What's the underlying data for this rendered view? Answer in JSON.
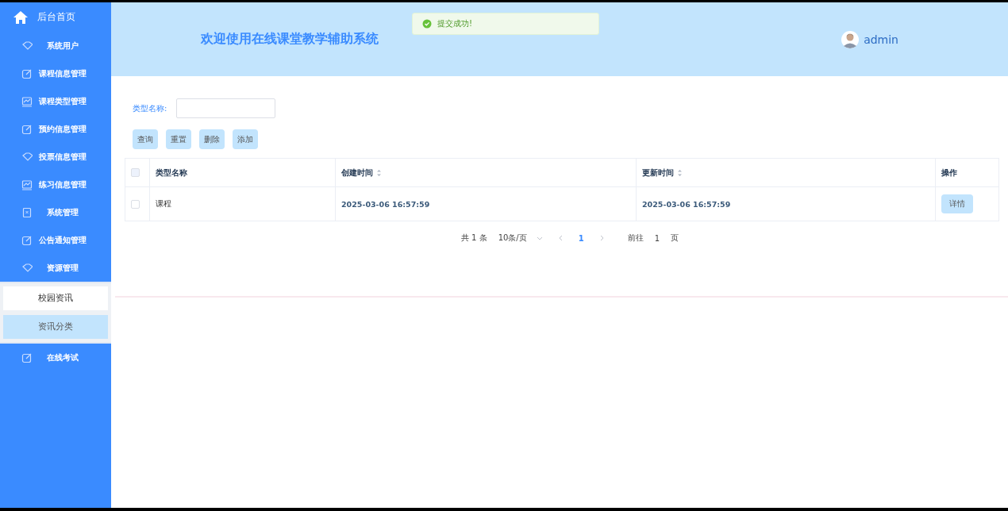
{
  "sidebar": {
    "home": "后台首页",
    "items": [
      {
        "label": "系统用户",
        "kind": "diamond"
      },
      {
        "label": "课程信息管理",
        "kind": "edit"
      },
      {
        "label": "课程类型管理",
        "kind": "chart"
      },
      {
        "label": "预约信息管理",
        "kind": "edit"
      },
      {
        "label": "投票信息管理",
        "kind": "diamond"
      },
      {
        "label": "练习信息管理",
        "kind": "chart"
      },
      {
        "label": "系统管理",
        "kind": "doc"
      },
      {
        "label": "公告通知管理",
        "kind": "edit"
      },
      {
        "label": "资源管理",
        "kind": "diamond",
        "expanded": true,
        "children": [
          {
            "label": "校园资讯",
            "selected": false
          },
          {
            "label": "资讯分类",
            "selected": true
          }
        ]
      },
      {
        "label": "在线考试",
        "kind": "edit",
        "expanded": false
      }
    ]
  },
  "header": {
    "title": "欢迎使用在线课堂教学辅助系统",
    "user": "admin"
  },
  "toast": {
    "kind": "success",
    "message": "提交成功!"
  },
  "filter": {
    "label": "类型名称:"
  },
  "buttons": [
    "查询",
    "重置",
    "删除",
    "添加"
  ],
  "table": {
    "all_checked": false,
    "columns": [
      {
        "label": "类型名称",
        "sortable": false
      },
      {
        "label": "创建时间",
        "sortable": true
      },
      {
        "label": "更新时间",
        "sortable": true
      },
      {
        "label": "操作",
        "sortable": false
      }
    ],
    "rows": [
      {
        "checked": false,
        "cells": [
          "课程",
          "2025-03-06 16:57:59",
          "2025-03-06 16:57:59"
        ],
        "action": "详情"
      }
    ]
  },
  "pagination": {
    "total": "共 1 条",
    "page_size": "10条/页",
    "pages": [
      {
        "label": "1",
        "selected": true
      }
    ],
    "goto_label": "前往",
    "goto_value": "1",
    "goto_suffix": "页"
  }
}
